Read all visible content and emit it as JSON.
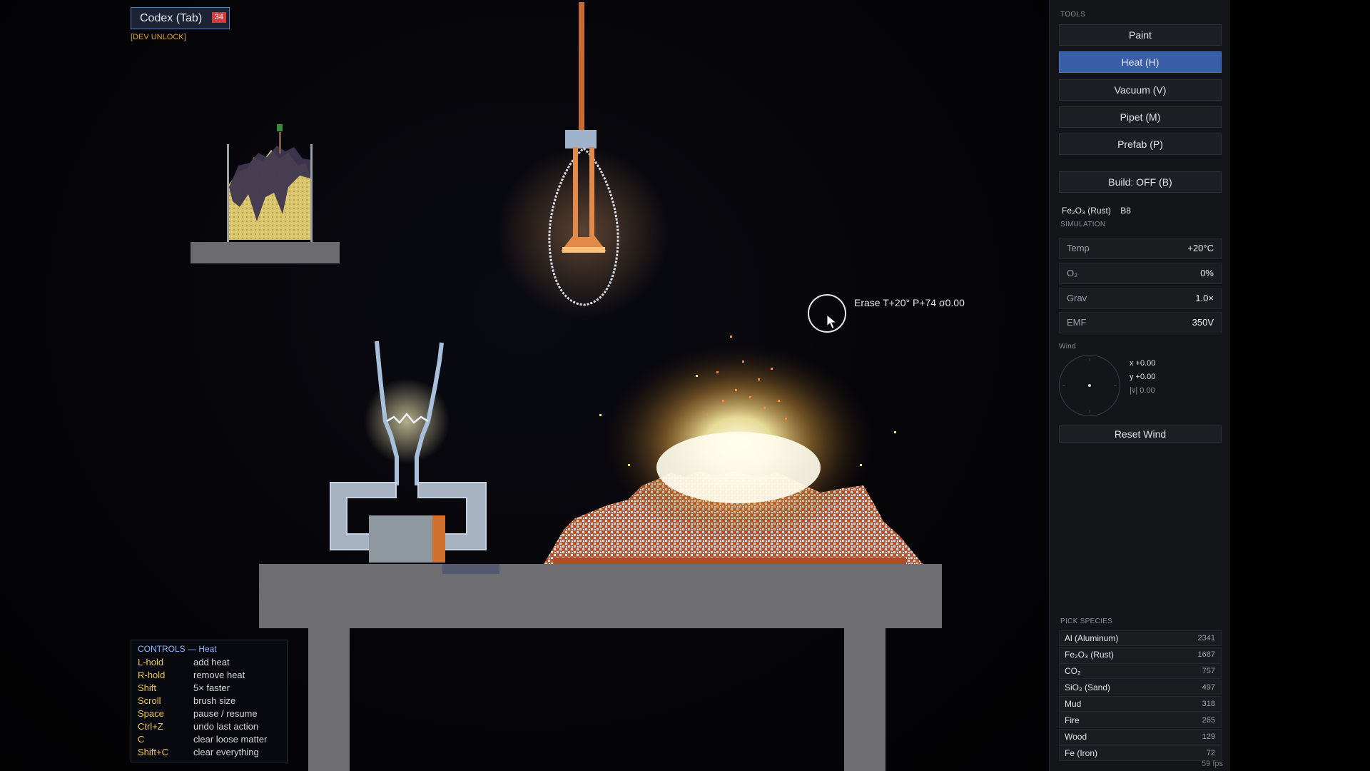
{
  "codex": {
    "label": "Codex (Tab)",
    "badge": "34",
    "dev_unlock": "[DEV UNLOCK]"
  },
  "brush": {
    "tooltip": "Erase  T+20°  P+74  σ0.00"
  },
  "controls": {
    "title": "CONTROLS — Heat",
    "rows": [
      {
        "key": "L-hold",
        "desc": "add heat"
      },
      {
        "key": "R-hold",
        "desc": "remove heat"
      },
      {
        "key": "Shift",
        "desc": "5× faster"
      },
      {
        "key": "Scroll",
        "desc": "brush size"
      },
      {
        "key": "Space",
        "desc": "pause / resume"
      },
      {
        "key": "Ctrl+Z",
        "desc": "undo last action"
      },
      {
        "key": "C",
        "desc": "clear loose matter"
      },
      {
        "key": "Shift+C",
        "desc": "clear everything"
      }
    ]
  },
  "panel": {
    "tools_label": "TOOLS",
    "tools": [
      {
        "label": "Paint",
        "active": false
      },
      {
        "label": "Heat (H)",
        "active": true
      },
      {
        "label": "Vacuum (V)",
        "active": false
      },
      {
        "label": "Pipet (M)",
        "active": false
      },
      {
        "label": "Prefab (P)",
        "active": false
      }
    ],
    "build_label": "Build: OFF (B)",
    "selected_species": "Fe₂O₃ (Rust)",
    "selected_code": "B8",
    "simulation_label": "SIMULATION",
    "stats": [
      {
        "label": "Temp",
        "value": "+20°C"
      },
      {
        "label": "O₂",
        "value": "0%"
      },
      {
        "label": "Grav",
        "value": "1.0×"
      },
      {
        "label": "EMF",
        "value": "350V"
      }
    ],
    "wind_label": "Wind",
    "wind": {
      "x": "x +0.00",
      "y": "y +0.00",
      "mag": "|v| 0.00"
    },
    "reset_wind_label": "Reset Wind",
    "species_label": "PICK SPECIES",
    "species": [
      {
        "name": "Al (Aluminum)",
        "count": "2341"
      },
      {
        "name": "Fe₂O₃ (Rust)",
        "count": "1687"
      },
      {
        "name": "CO₂",
        "count": "757"
      },
      {
        "name": "SiO₂ (Sand)",
        "count": "497"
      },
      {
        "name": "Mud",
        "count": "318"
      },
      {
        "name": "Fire",
        "count": "265"
      },
      {
        "name": "Wood",
        "count": "129"
      },
      {
        "name": "Fe (Iron)",
        "count": "72"
      }
    ],
    "fps": "59 fps"
  },
  "colors": {
    "accent": "#3a5ea8",
    "badge": "#d23c3c",
    "key_yellow": "#f0c845",
    "controls_title": "#8fb4ff",
    "dev_unlock": "#d7a33a",
    "rust": "#c0562a",
    "aluminum": "#c9ccd3",
    "stone": "#6d6d72"
  }
}
